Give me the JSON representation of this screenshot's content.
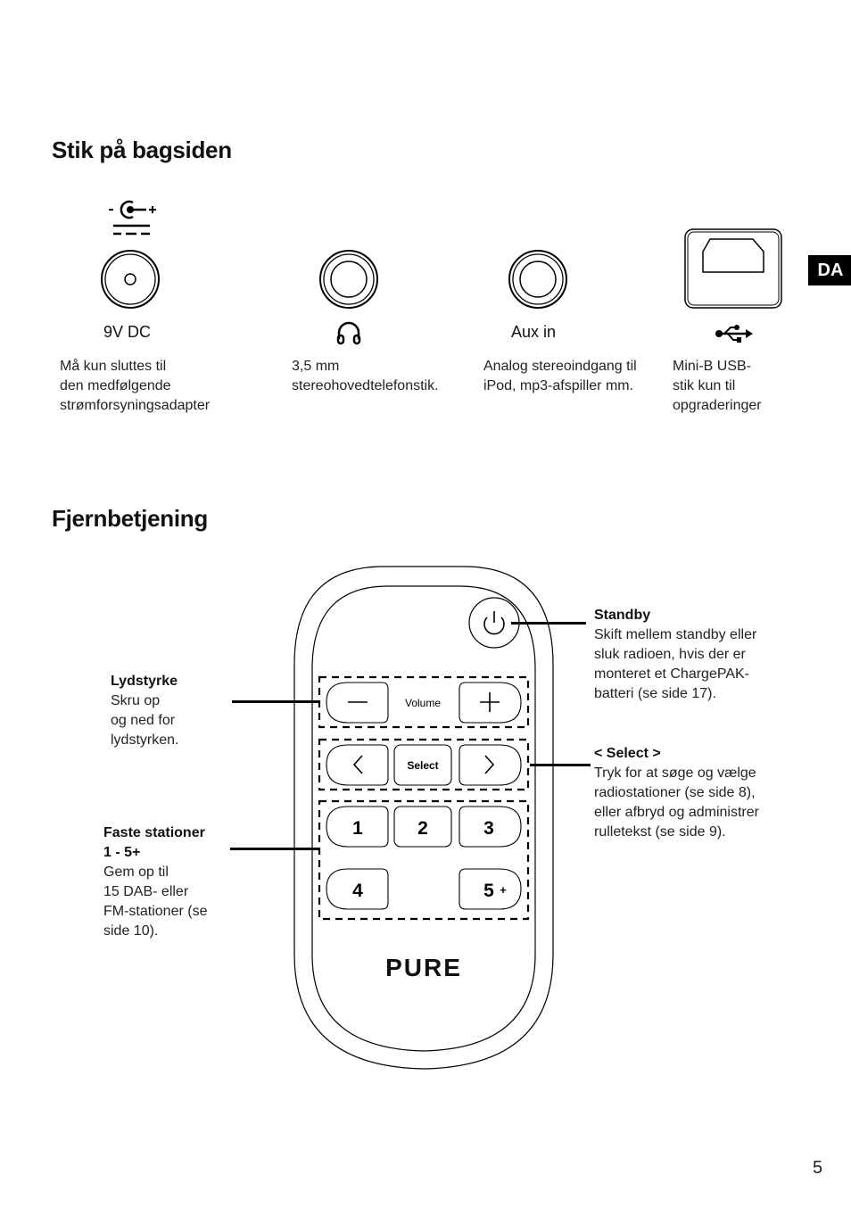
{
  "lang_tab": "DA",
  "page_number": "5",
  "section1": {
    "title": "Stik på bagsiden",
    "connectors": [
      {
        "icon": "dc-polarity-icon",
        "label": "9V DC",
        "description": "Må kun sluttes til\nden medfølgende\nstrømforsyningsadapter"
      },
      {
        "icon": "headphones-icon",
        "label": "",
        "description": "3,5 mm\nstereohovedtelefonstik."
      },
      {
        "icon": "audio-jack-icon",
        "label": "Aux in",
        "description": "Analog stereoindgang til\niPod, mp3-afspiller mm."
      },
      {
        "icon": "usb-icon",
        "label": "",
        "description": "Mini-B USB-\nstik kun til\nopgraderinger"
      }
    ]
  },
  "section2": {
    "title": "Fjernbetjening",
    "remote": {
      "volume_label": "Volume",
      "select_label": "Select",
      "presets": [
        "1",
        "2",
        "3",
        "4",
        "5"
      ],
      "preset5_suffix": "+",
      "brand": "PURE"
    },
    "callouts": {
      "volume": {
        "title": "Lydstyrke",
        "text": "Skru op\nog ned for\nlydstyrken."
      },
      "presets": {
        "title": "Faste stationer\n1 - 5+",
        "text": "Gem op til\n15 DAB- eller\nFM-stationer (se\nside 10)."
      },
      "standby": {
        "title": "Standby",
        "text": "Skift mellem standby eller\nsluk radioen, hvis der er\nmonteret et ChargePAK-\nbatteri (se side 17)."
      },
      "select": {
        "title": "< Select >",
        "text": "Tryk for at søge og vælge\nradiostationer (se side 8),\neller afbryd og administrer\nrulletekst (se side 9)."
      }
    }
  }
}
